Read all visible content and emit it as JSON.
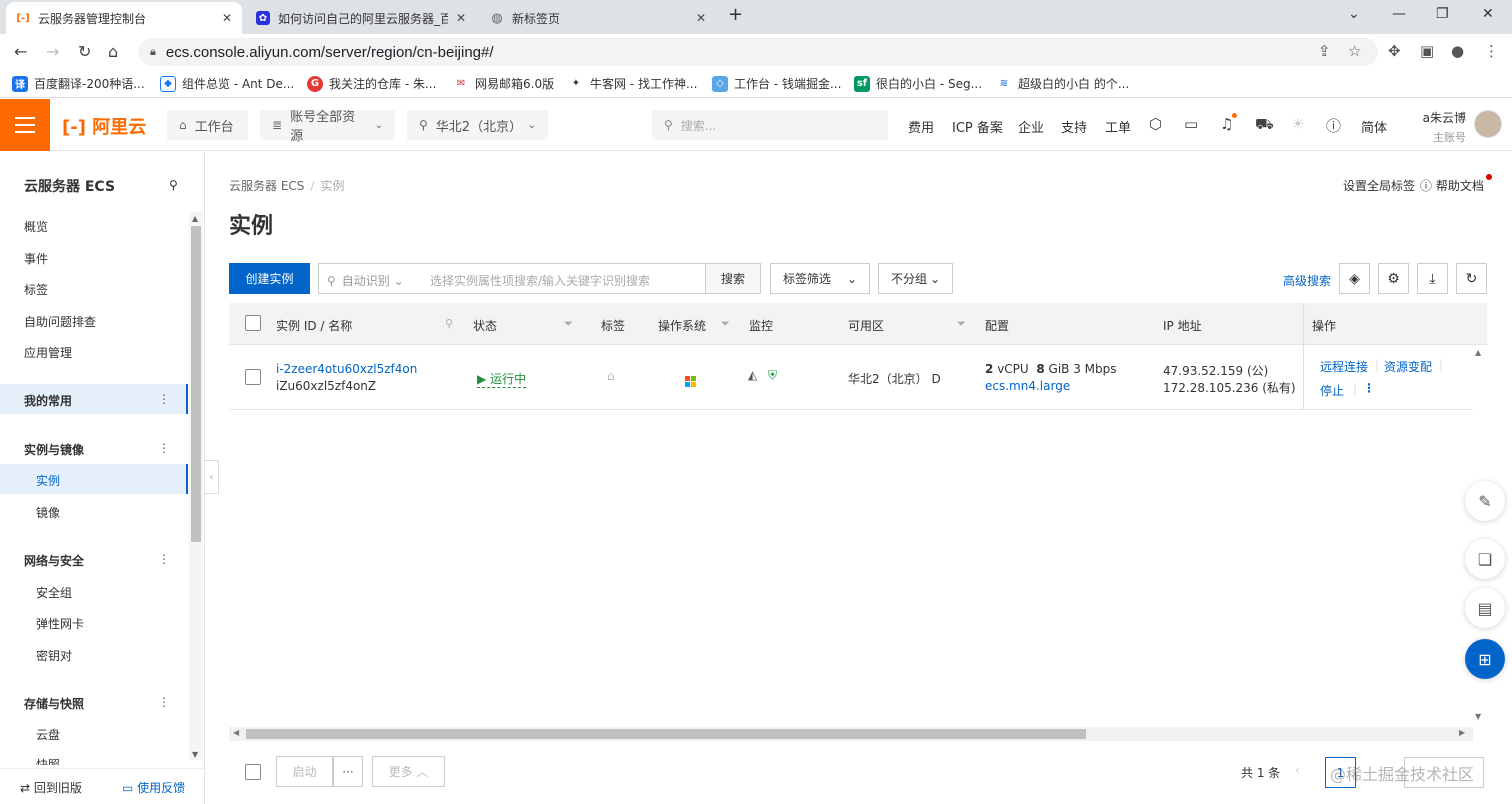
{
  "browser": {
    "tabs": [
      {
        "title": "云服务器管理控制台",
        "icon": "aliyun-icon"
      },
      {
        "title": "如何访问自己的阿里云服务器_百",
        "icon": "baidu-icon"
      },
      {
        "title": "新标签页",
        "icon": "globe-icon"
      }
    ],
    "close": "✕",
    "new_tab": "+",
    "url": "ecs.console.aliyun.com/server/region/cn-beijing#/",
    "bookmarks": [
      {
        "label": "百度翻译-200种语...",
        "color": "#1a73e8"
      },
      {
        "label": "组件总览 - Ant De...",
        "color": "#1677ff"
      },
      {
        "label": "我关注的仓库 - 朱...",
        "color": "#e53935"
      },
      {
        "label": "网易邮箱6.0版",
        "color": "#d32f2f"
      },
      {
        "label": "牛客网 - 找工作神...",
        "color": "#ffffff"
      },
      {
        "label": "工作台 - 钱端掘金...",
        "color": "#5aa6e8"
      },
      {
        "label": "很白的小白 - Seg...",
        "color": "#009a61"
      },
      {
        "label": "超级白的小白 的个...",
        "color": "#3b7fd9"
      }
    ]
  },
  "topbar": {
    "logo": "[-] 阿里云",
    "workbench": "工作台",
    "resources": "账号全部资源",
    "region": "华北2（北京）",
    "search_placeholder": "搜索...",
    "links": [
      "费用",
      "ICP 备案",
      "企业",
      "支持",
      "工单"
    ],
    "lang": "简体",
    "user_name": "a朱云博",
    "user_role": "主账号"
  },
  "sidebar": {
    "title": "云服务器 ECS",
    "top_items": [
      "概览",
      "事件",
      "标签",
      "自助问题排查",
      "应用管理"
    ],
    "favorites": "我的常用",
    "groups": [
      {
        "label": "实例与镜像",
        "items": [
          "实例",
          "镜像"
        ]
      },
      {
        "label": "网络与安全",
        "items": [
          "安全组",
          "弹性网卡",
          "密钥对"
        ]
      },
      {
        "label": "存储与快照",
        "items": [
          "云盘",
          "快照"
        ]
      }
    ],
    "back_old": "回到旧版",
    "feedback": "使用反馈"
  },
  "main": {
    "breadcrumb": [
      "云服务器 ECS",
      "实例"
    ],
    "breadcrumb_sep": "/",
    "global_tag": "设置全局标签",
    "help": "帮助文档",
    "title": "实例",
    "create_btn": "创建实例",
    "auto_detect": "自动识别",
    "search_placeholder": "选择实例属性项搜索/输入关键字识别搜索",
    "search_btn": "搜索",
    "tag_filter": "标签筛选",
    "group": "不分组",
    "advanced": "高级搜索",
    "columns": [
      "实例 ID / 名称",
      "状态",
      "标签",
      "操作系统",
      "监控",
      "可用区",
      "配置",
      "IP 地址",
      "操作"
    ],
    "row": {
      "id": "i-2zeer4otu60xzl5zf4on",
      "name": "iZu60xzl5zf4onZ",
      "status": "运行中",
      "zone": "华北2（北京） D",
      "cpu": "2",
      "cpu_unit": "vCPU",
      "mem": "8",
      "mem_unit": "GiB 3 Mbps",
      "type": "ecs.mn4.large",
      "ip_public": "47.93.52.159 (公)",
      "ip_private": "172.28.105.236 (私有)",
      "op_remote": "远程连接",
      "op_change": "资源变配",
      "op_stop": "停止"
    },
    "footer": {
      "start": "启动",
      "dots": "···",
      "more": "更多",
      "total": "共 1 条",
      "page": "1"
    },
    "watermark": "@稀土掘金技术社区"
  }
}
